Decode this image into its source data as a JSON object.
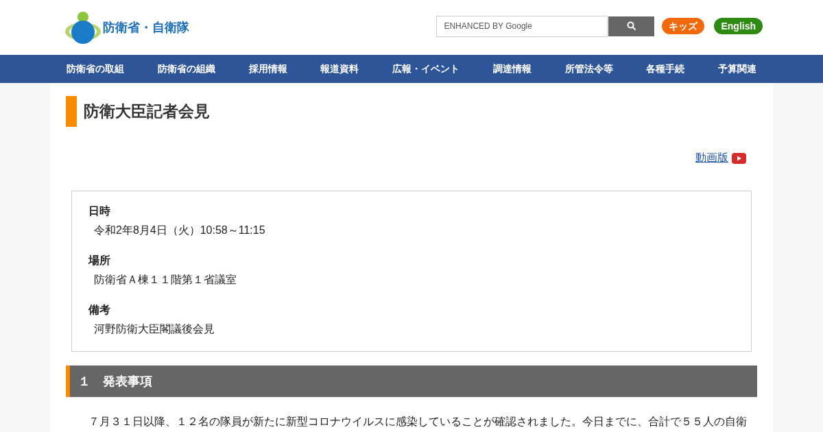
{
  "header": {
    "logo_text": "防衛省・自衛隊",
    "search": {
      "placeholder": "ENHANCED BY Google"
    },
    "links": [
      {
        "label": "キッズ",
        "kind": "kids"
      },
      {
        "label": "English",
        "kind": "english"
      }
    ]
  },
  "nav": [
    {
      "label": "防衛省の取組"
    },
    {
      "label": "防衛省の組織"
    },
    {
      "label": "採用情報"
    },
    {
      "label": "報道資料"
    },
    {
      "label": "広報・イベント"
    },
    {
      "label": "調達情報"
    },
    {
      "label": "所管法令等"
    },
    {
      "label": "各種手続"
    },
    {
      "label": "予算関連"
    }
  ],
  "page_title": "防衛大臣記者会見",
  "video_link": "動画版",
  "info": [
    {
      "label": "日時",
      "value": "令和2年8月4日（火）10:58～11:15"
    },
    {
      "label": "場所",
      "value": "防衛省Ａ棟１１階第１省議室"
    },
    {
      "label": "備考",
      "value": "河野防衛大臣閣議後会見"
    }
  ],
  "section": {
    "heading": "１　発表事項",
    "text": "７月３１日以降、１２名の隊員が新たに新型コロナウイルスに感染していることが確認されました。今日までに、合計で５５人の自衛"
  }
}
